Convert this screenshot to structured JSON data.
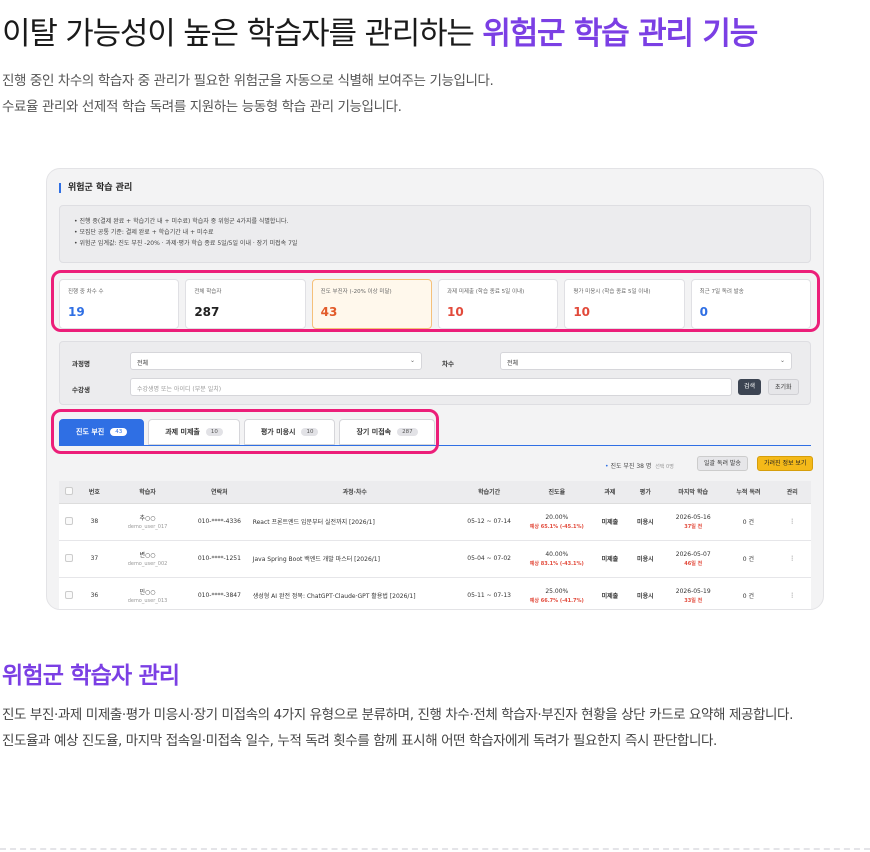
{
  "hero": {
    "title_plain": "이탈 가능성이 높은 학습자를 관리하는 ",
    "title_accent": "위험군 학습 관리 기능",
    "desc_line1": "진행 중인 차수의 학습자 중 관리가 필요한 위험군을 자동으로 식별해 보여주는 기능입니다.",
    "desc_line2": "수료율 관리와 선제적 학습 독려를 지원하는 능동형 학습 관리 기능입니다."
  },
  "panel": {
    "title": "위험군 학습 관리",
    "notice": [
      "진행 중(결제 완료 + 학습기간 내 + 미수료) 학습자 중 위험군 4가지를 식별합니다.",
      "모집단 공통 기준: 결제 완료 + 학습기간 내 + 미수료",
      "위험군 임계값: 진도 부진 -20% · 과제·평가 학습 종료 5일/5일 이내 · 장기 미접속 7일"
    ],
    "cards": [
      {
        "label": "진행 중 차수 수",
        "value": "19",
        "tone": "blue"
      },
      {
        "label": "전체 학습자",
        "value": "287",
        "tone": "dark"
      },
      {
        "label": "진도 부진자 (-20% 이상 미달)",
        "value": "43",
        "tone": "orange"
      },
      {
        "label": "과제 미제출 (학습 종료 5일 이내)",
        "value": "10",
        "tone": "red"
      },
      {
        "label": "평가 미응시 (학습 종료 5일 이내)",
        "value": "10",
        "tone": "red"
      },
      {
        "label": "최근 7일 독려 발송",
        "value": "0",
        "tone": "blue"
      }
    ],
    "filter": {
      "course_label": "과정명",
      "course_value": "전체",
      "round_label": "차수",
      "round_value": "전체",
      "student_label": "수강생",
      "student_placeholder": "수강생명 또는 아이디 (부분 일치)",
      "search_btn": "검색",
      "reset_btn": "초기화"
    },
    "tabs": [
      {
        "label": "진도 부진",
        "count": "43"
      },
      {
        "label": "과제 미제출",
        "count": "10"
      },
      {
        "label": "평가 미응시",
        "count": "10"
      },
      {
        "label": "장기 미접속",
        "count": "287"
      }
    ],
    "toolbar": {
      "info": "진도 부진 38 명",
      "selected": "선택 0명",
      "bulk_btn": "일괄 독려 발송",
      "masked_btn": "가려진 정보 보기"
    },
    "columns": [
      "번호",
      "학습자",
      "연락처",
      "과정·차수",
      "학습기간",
      "진도율",
      "과제",
      "평가",
      "마지막 학습",
      "누적 독려",
      "관리"
    ],
    "rows": [
      {
        "no": "38",
        "name": "추○○",
        "id": "demo_user_017",
        "phone": "010-****-4336",
        "course": "React 프론트엔드 입문부터 실전까지 [2026/1]",
        "period": "05-12 ~ 07-14",
        "progress": "20.00%",
        "pred": "예상 65.1% (-45.1%)",
        "task": "미제출",
        "eval": "미응시",
        "last": "2026-05-16",
        "days": "37일 전",
        "nudge": "0 건"
      },
      {
        "no": "37",
        "name": "변○○",
        "id": "demo_user_002",
        "phone": "010-****-1251",
        "course": "Java Spring Boot 백엔드 개발 마스터 [2026/1]",
        "period": "05-04 ~ 07-02",
        "progress": "40.00%",
        "pred": "예상 83.1% (-43.1%)",
        "task": "미제출",
        "eval": "미응시",
        "last": "2026-05-07",
        "days": "46일 전",
        "nudge": "0 건"
      },
      {
        "no": "36",
        "name": "민○○",
        "id": "demo_user_013",
        "phone": "010-****-3847",
        "course": "생성형 AI 완전 정복: ChatGPT·Claude·GPT 활용법 [2026/1]",
        "period": "05-11 ~ 07-13",
        "progress": "25.00%",
        "pred": "예상 66.7% (-41.7%)",
        "task": "미제출",
        "eval": "미응시",
        "last": "2026-05-19",
        "days": "33일 전",
        "nudge": "0 건"
      }
    ]
  },
  "section": {
    "title": "위험군 학습자 관리",
    "desc_line1": "진도 부진·과제 미제출·평가 미응시·장기 미접속의 4가지 유형으로 분류하며, 진행 차수·전체 학습자·부진자 현황을 상단 카드로 요약해 제공합니다.",
    "desc_line2": "진도율과 예상 진도율, 마지막 접속일·미접속 일수, 누적 독려 횟수를 함께 표시해 어떤 학습자에게 독려가 필요한지 즉시 판단합니다."
  },
  "colors": {
    "accent": "#7b3fe4",
    "highlight": "#ec1e79",
    "primary": "#2f6fe4",
    "danger": "#e24a3b"
  }
}
